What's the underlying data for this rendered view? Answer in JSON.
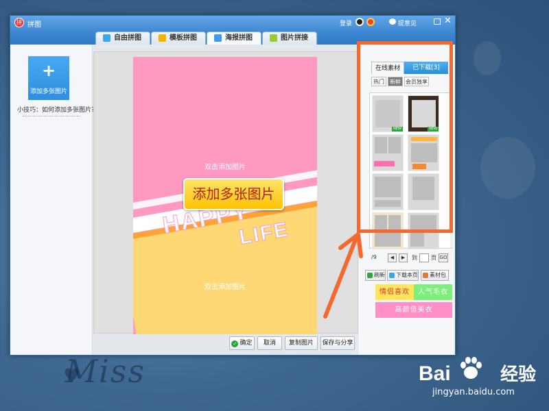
{
  "window": {
    "app_title": "拼图",
    "login": "登录",
    "feedback": "提意见",
    "close_glyph": "✕"
  },
  "tabs": [
    {
      "label": "自由拼图",
      "active": false,
      "color": "#3aa8e8"
    },
    {
      "label": "模板拼图",
      "active": false,
      "color": "#f5b400"
    },
    {
      "label": "海报拼图",
      "active": true,
      "color": "#3d9be9"
    },
    {
      "label": "图片拼接",
      "active": false,
      "color": "#9ccc33"
    }
  ],
  "left": {
    "add_plus": "+",
    "add_label": "添加多张图片",
    "tip": "小技巧：如何添加多张图片？"
  },
  "poster": {
    "hint_top": "双击添加图片",
    "hint_bottom": "双击添加图片",
    "big_button": "添加多张图片",
    "happy": "HAPPY",
    "life": "LIFE"
  },
  "bottom_buttons": {
    "confirm": "确定",
    "cancel": "取消",
    "copy": "复制图片",
    "save_share": "保存与分享"
  },
  "right": {
    "tab_online": "在线素材",
    "tab_downloaded": "已下载[3]",
    "subtab_hot": "热门",
    "subtab_new": "新鲜",
    "subtab_vip": "会员独享",
    "new_badge": "NEW",
    "page_prefix": "/9",
    "page_prev": "◀",
    "page_next": "▶",
    "page_to": "到",
    "page_suffix": "页",
    "go": "GO",
    "refresh": "刷新",
    "download_page": "下载本页",
    "material_pack": "素材包",
    "promo_1": "情侣喜欢",
    "promo_2": "人气毛衣",
    "promo_3": "高颜值美衣"
  },
  "background": {
    "text": "Miss"
  },
  "watermark": {
    "logo": "Bai",
    "logo_tail": "百",
    "cn": "经验",
    "url": "jingyan.baidu.com"
  },
  "colors": {
    "accent_blue": "#2e8fe2",
    "highlight_orange": "#f5682e",
    "poster_pink": "#ff99c2",
    "poster_yellow": "#ffd876"
  }
}
